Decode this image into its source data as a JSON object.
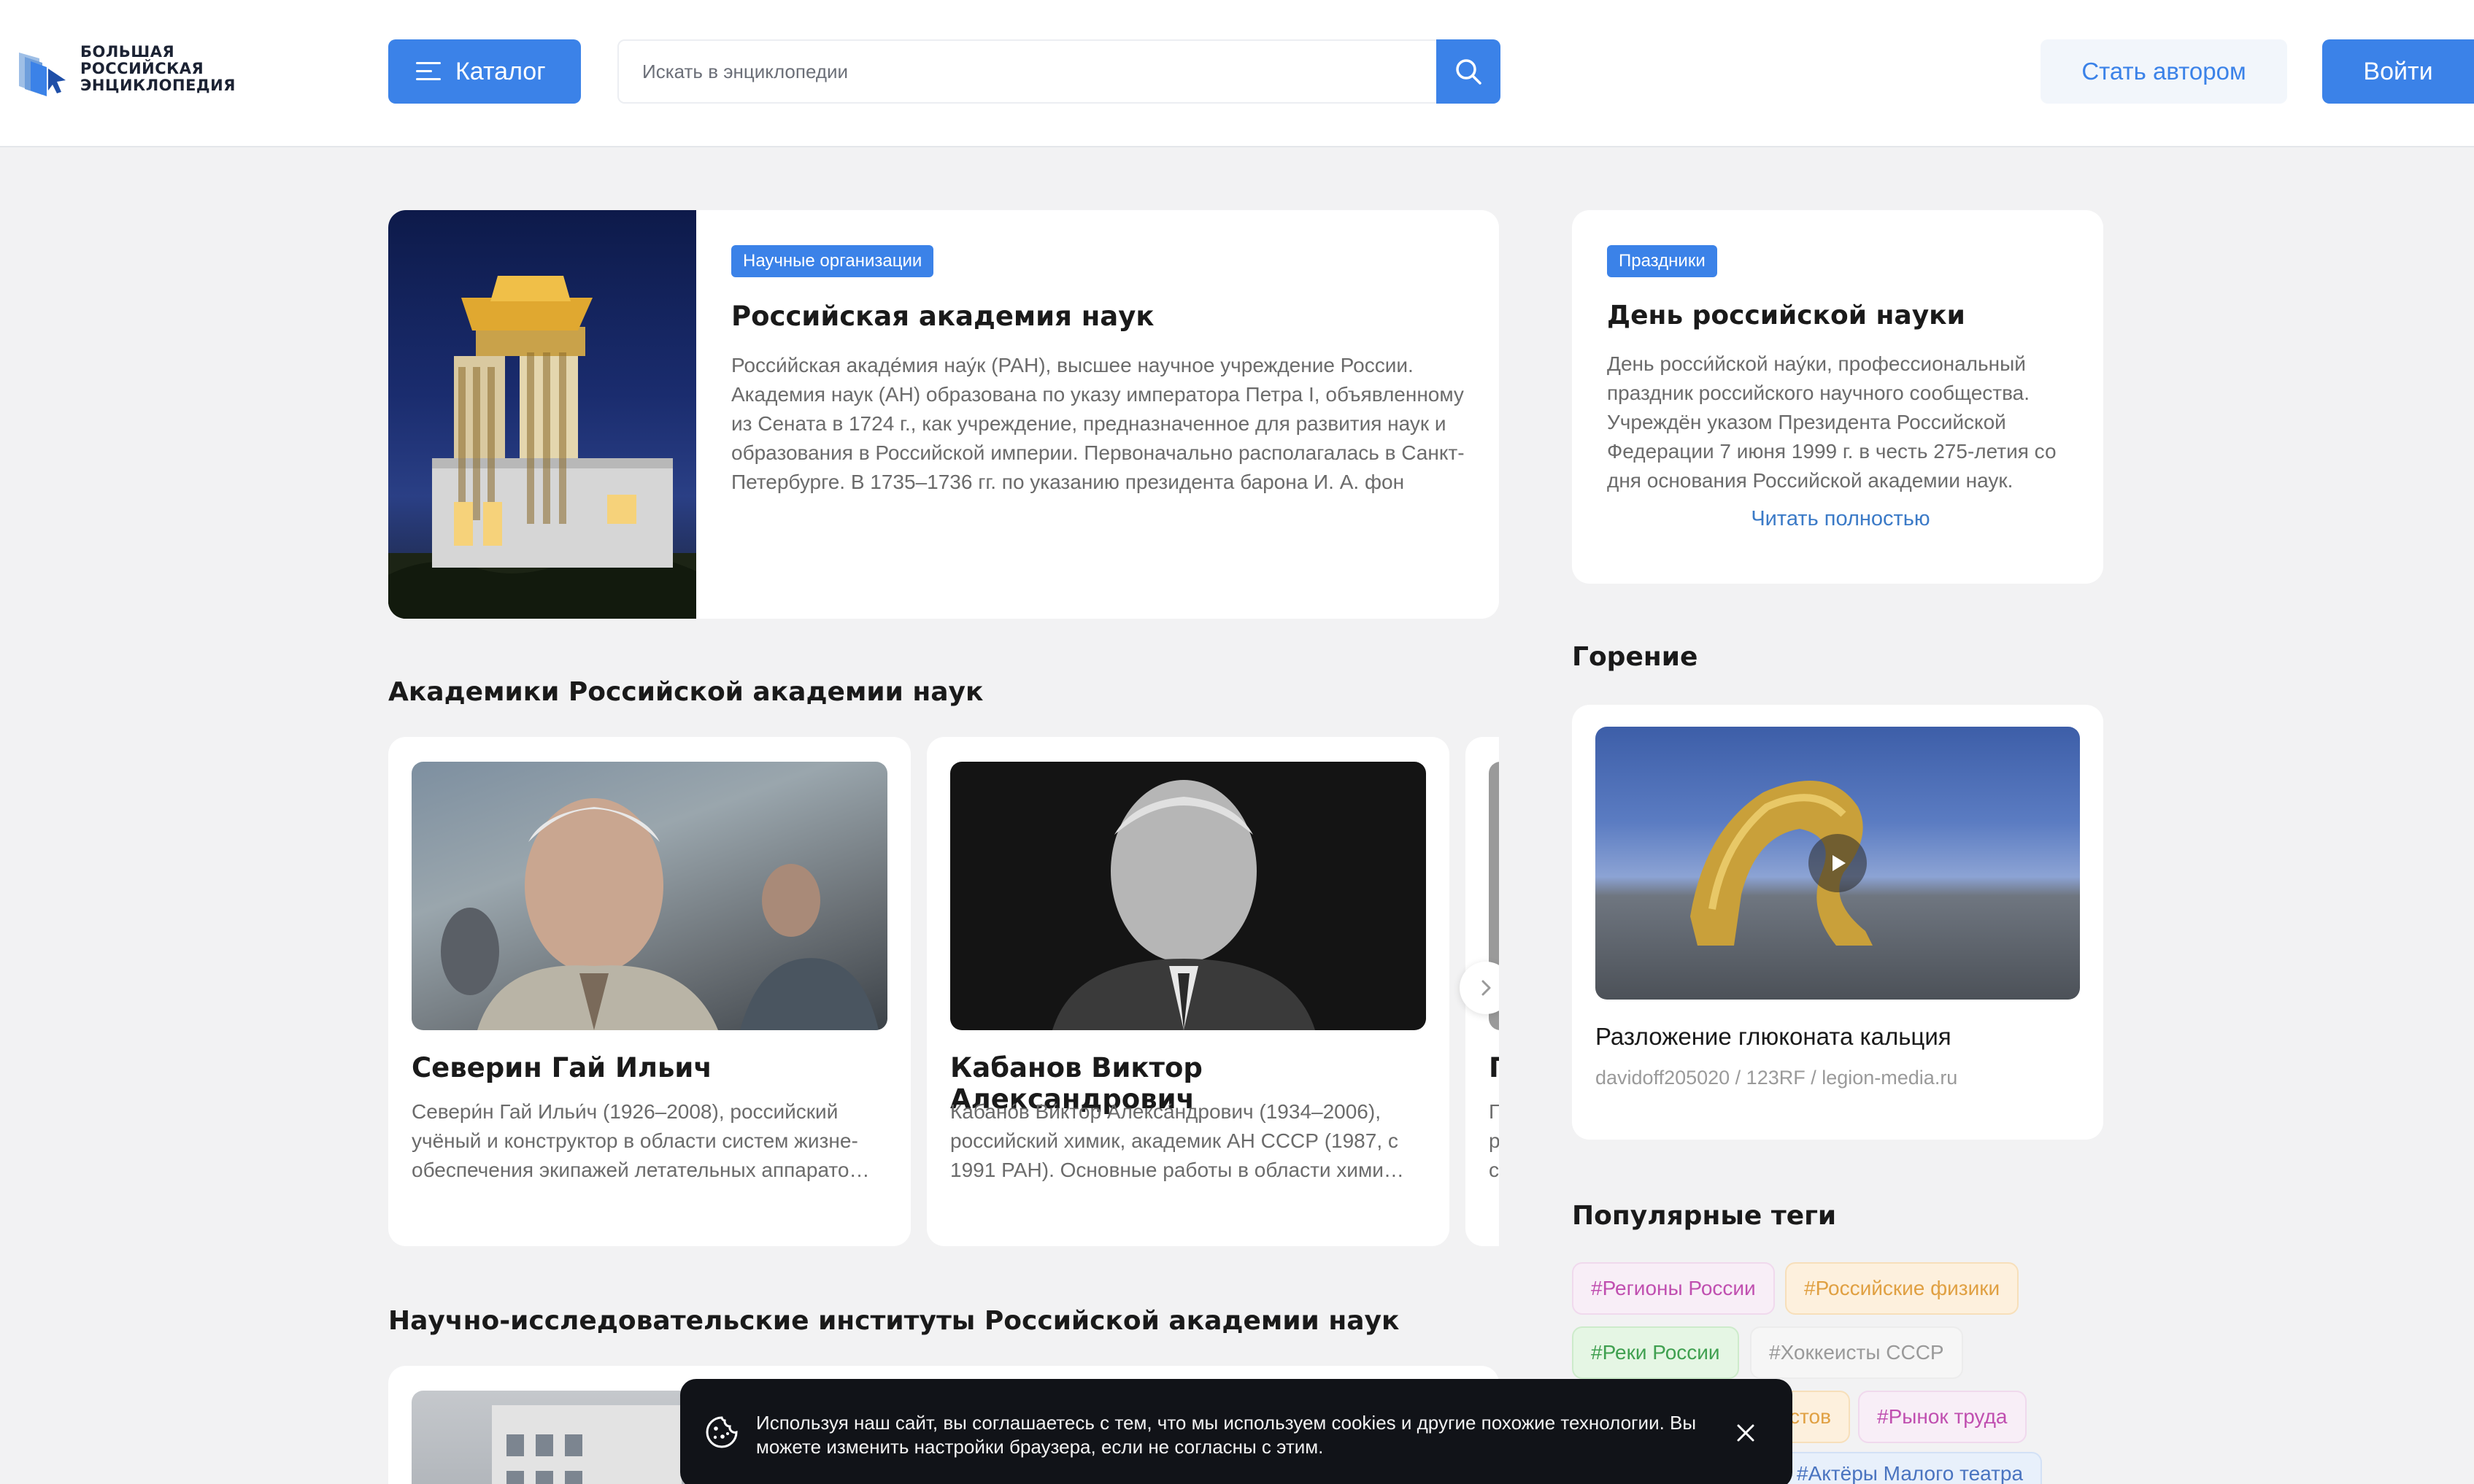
{
  "header": {
    "logo_lines": [
      "БОЛЬШАЯ",
      "РОССИЙСКАЯ",
      "ЭНЦИКЛОПЕДИЯ"
    ],
    "catalog_label": "Каталог",
    "search_placeholder": "Искать в энциклопедии",
    "author_label": "Стать автором",
    "login_label": "Войти",
    "accent_color": "#3b82e8"
  },
  "featured": {
    "tag": "Научные организации",
    "title": "Российская академия наук",
    "text": "Росси́йская акаде́мия нау́к (РАН), высшее научное учреждение России. Академия наук (АН) образована по указу императора Петра I, объявленному из Сената в 1724 г., как учреждение, предназначенное для развития наук и образования в Российской империи. Первоначально располагалась в Санкт-Петербурге. В 1735–1736 гг. по указанию президента барона И. А. фон Корфа появились научные подразделения…"
  },
  "holiday": {
    "tag": "Праздники",
    "title": "День российской науки",
    "text": "День росси́йской нау́ки, профессиональный праздник российского научного сообщества. Учреждён указом Президента Российской Федерации 7 июня 1999 г. в честь 275-летия со дня основания Российской академии наук.",
    "read_more": "Читать полностью"
  },
  "academicians": {
    "title": "Академики Российской академии наук",
    "items": [
      {
        "name": "Северин Гай Ильич",
        "text": "Севери́н Гай Ильи́ч (1926–2008), российский учёный и конструктор в области систем жизне­обеспечения экипажей летательных аппарато…"
      },
      {
        "name": "Кабанов Виктор Александрович",
        "text": "Кабано́в Ви́ктор Алекса́ндрович (1934–2006), российский химик, академик АН СССР (1987, с 1991 РАН). Основные работы в области хими…"
      },
      {
        "name": "Г",
        "text_lines": [
          "Г",
          "р",
          "с"
        ]
      }
    ]
  },
  "institutes": {
    "title": "Научно-исследовательские институты Российской академии наук"
  },
  "video": {
    "section_title": "Горение",
    "caption": "Разложение глюконата кальция",
    "credit": "davidoff205020 / 123RF / legion-media.ru"
  },
  "tags": {
    "title": "Популярные теги",
    "items": [
      {
        "label": "#Регионы России",
        "color": "#c04fb0",
        "bg": "#f8eef7"
      },
      {
        "label": "#Российские физики",
        "color": "#e0a042",
        "bg": "#fdf0dd"
      },
      {
        "label": "#Реки России",
        "color": "#3fa050",
        "bg": "#e5f6e4"
      },
      {
        "label": "#Хоккеисты СССР",
        "color": "#9a9a9a",
        "bg": "#f3f3f3"
      },
      {
        "label": "стов",
        "color": "#e0a042",
        "bg": "#fdf0dd"
      },
      {
        "label": "#Рынок труда",
        "color": "#c04fb0",
        "bg": "#f8eef7"
      },
      {
        "label": "#Актёры Малого театра",
        "color": "#4a74c0",
        "bg": "#e8f0fb"
      }
    ]
  },
  "cookie": {
    "text": "Используя наш сайт, вы соглашаетесь с тем, что мы используем cookies и другие похожие технологии. Вы можете изменить настройки браузера, если не согласны с этим."
  }
}
